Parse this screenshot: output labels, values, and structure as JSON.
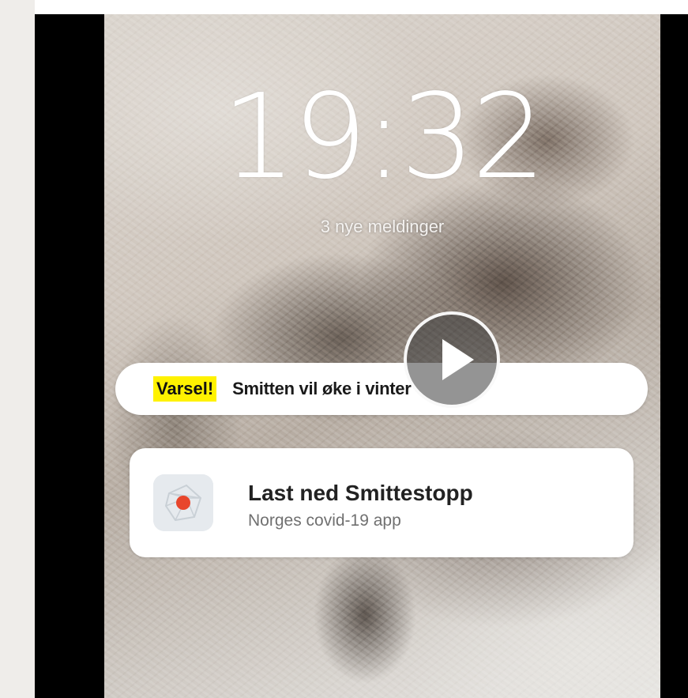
{
  "lockscreen": {
    "time": "19:32",
    "messages": "3 nye meldinger"
  },
  "alert": {
    "badge": "Varsel!",
    "text": "Smitten vil øke i vinter"
  },
  "notification": {
    "title": "Last ned Smittestopp",
    "subtitle": "Norges covid-19 app",
    "icon": "smittestopp-app-icon"
  },
  "video": {
    "control_icon": "play-icon"
  }
}
